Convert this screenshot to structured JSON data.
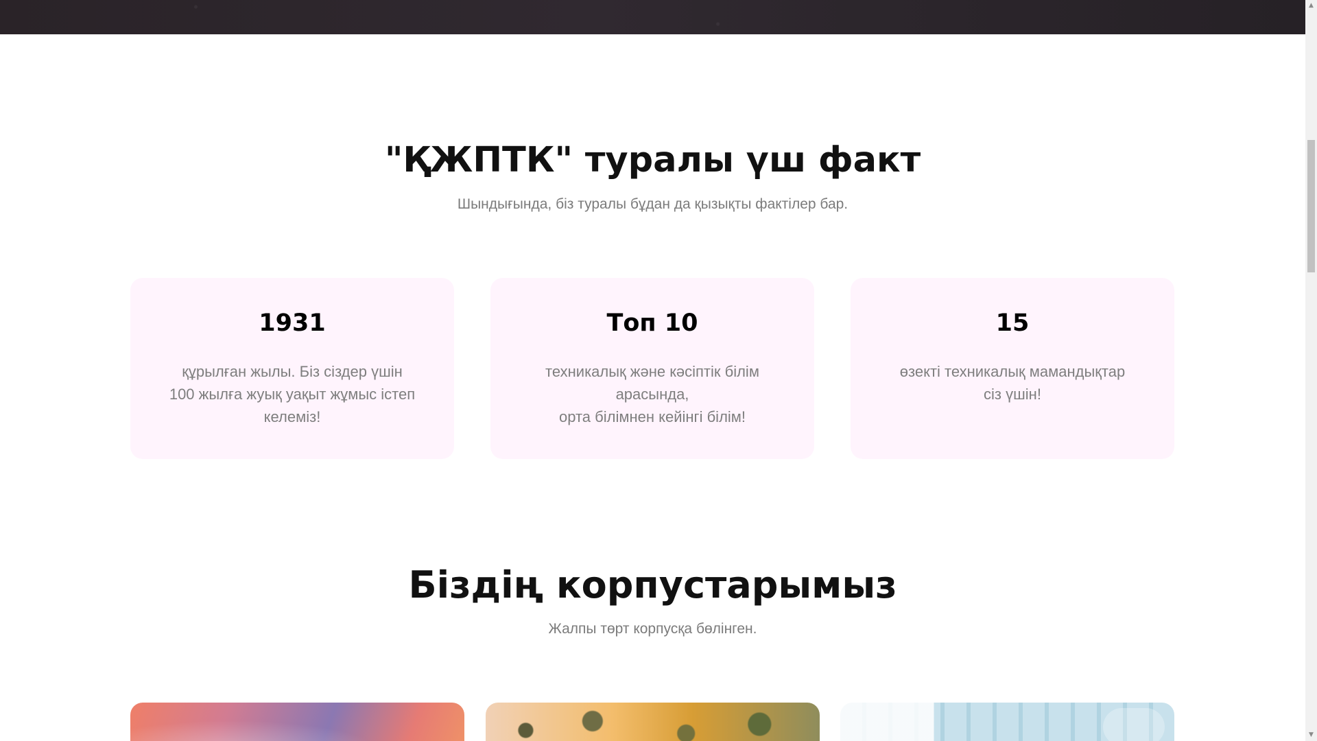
{
  "facts_section": {
    "title": "\"ҚЖПТК\" туралы үш факт",
    "subtitle": "Шындығында, біз туралы бұдан да қызықты фактілер бар.",
    "cards": [
      {
        "value": "1931",
        "text": "құрылған жылы. Біз сіздер үшін\n100 жылға жуық уақыт жұмыс істеп\nкелеміз!"
      },
      {
        "value": "Топ 10",
        "text": "техникалық және кәсіптік білім\nарасында,\nорта білімнен кейінгі білім!"
      },
      {
        "value": "15",
        "text": "өзекті техникалық мамандықтар\nсіз үшін!"
      }
    ]
  },
  "campuses_section": {
    "title": "Біздің корпустарымыз",
    "subtitle": "Жалпы төрт корпусқа бөлінген."
  },
  "colors": {
    "fact_card_background": "#fff4fd",
    "title_text": "#111111",
    "muted_text": "#7e7e7e"
  },
  "scrollbar": {
    "up_icon": "triangle-up",
    "down_icon": "triangle-down"
  }
}
